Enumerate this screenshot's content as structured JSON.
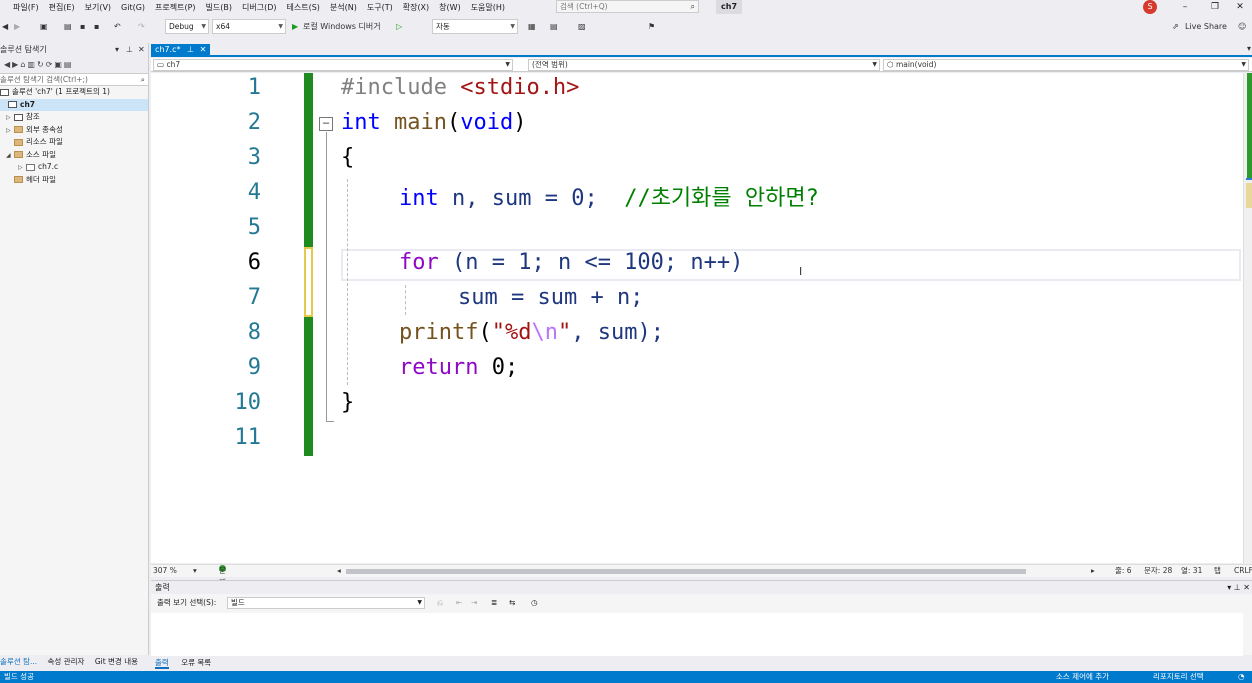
{
  "menu": [
    "파일(F)",
    "편집(E)",
    "보기(V)",
    "Git(G)",
    "프로젝트(P)",
    "빌드(B)",
    "디버그(D)",
    "테스트(S)",
    "분석(N)",
    "도구(T)",
    "확장(X)",
    "창(W)",
    "도움말(H)"
  ],
  "search": {
    "placeholder": "검색 (Ctrl+Q)"
  },
  "project_name": "ch7",
  "avatar_initial": "S",
  "live_share": "Live Share",
  "toolbar": {
    "config": "Debug",
    "platform": "x64",
    "run_label": "로컬 Windows 디버거",
    "auto": "자동"
  },
  "solution_explorer": {
    "title": "솔루션 탐색기",
    "search_placeholder": "솔루션 탐색기 검색(Ctrl+;)",
    "solution": "솔루션 'ch7' (1 프로젝트의 1)",
    "project": "ch7",
    "items": [
      "참조",
      "외부 종속성",
      "리소스 파일",
      "소스 파일",
      "ch7.c",
      "헤더 파일"
    ]
  },
  "left_bottom_tabs": [
    "솔루션 탐...",
    "속성 관리자",
    "Git 변경 내용"
  ],
  "editor": {
    "tab": "ch7.c*",
    "nav_project": "ch7",
    "nav_scope": "(전역 범위)",
    "nav_function": "main(void)",
    "line_numbers": [
      "1",
      "2",
      "3",
      "4",
      "5",
      "6",
      "7",
      "8",
      "9",
      "10",
      "11"
    ],
    "current_line": 6
  },
  "code": {
    "l1_directive": "#include",
    "l1_header": "<stdio.h>",
    "l2_type": "int",
    "l2_func": "main",
    "l2_open": "(",
    "l2_void": "void",
    "l2_close": ")",
    "l3": "{",
    "l4_type": "int",
    "l4_rest": "n, sum = 0;",
    "l4_comment": "//초기화를 안하면?",
    "l6_kw": "for",
    "l6_rest": "(n = 1; n <= 100; n++)",
    "l7": "sum = sum + n;",
    "l8_fn": "printf",
    "l8_open": "(",
    "l8_str_a": "\"%d",
    "l8_esc": "\\n",
    "l8_str_b": "\"",
    "l8_rest": ", sum);",
    "l9_kw": "return",
    "l9_rest": "0;",
    "l10": "}"
  },
  "status": {
    "zoom": "307 %",
    "issues": "문제가 검색되지 않음",
    "line": "줄: 6",
    "char": "문자: 28",
    "col": "열: 31",
    "tab": "탭",
    "eol": "CRLF"
  },
  "output": {
    "title": "출력",
    "show_label": "출력 보기 선택(S):",
    "source": "빌드"
  },
  "bottom_tabs": [
    "출력",
    "오류 목록"
  ],
  "statusbar": {
    "left": "빌드 성공",
    "source_control": "소스 제어에 추가",
    "repo": "리포지토리 선택"
  }
}
